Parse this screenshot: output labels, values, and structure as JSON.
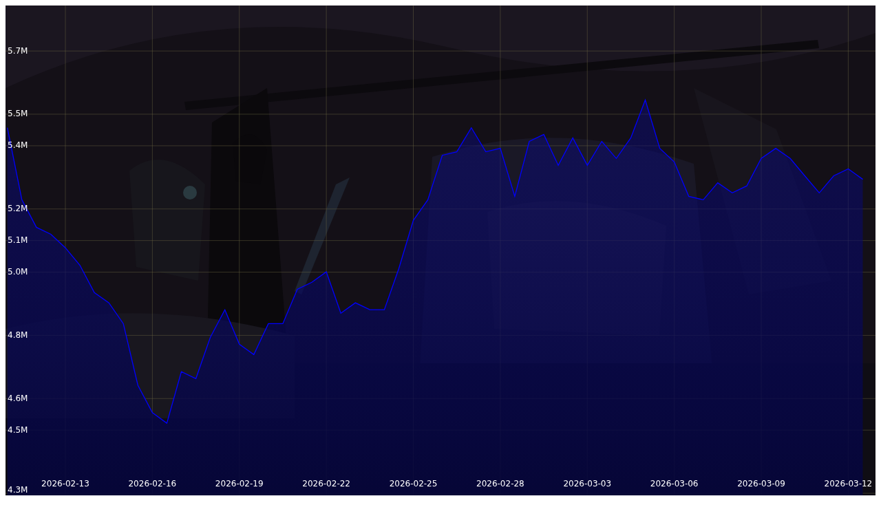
{
  "chart": {
    "chart_data": {
      "type": "area",
      "categories": [
        null,
        null,
        null,
        null,
        "2026-02-13",
        null,
        null,
        null,
        null,
        null,
        "2026-02-16",
        null,
        null,
        null,
        null,
        null,
        "2026-02-19",
        null,
        null,
        null,
        null,
        null,
        "2026-02-22",
        null,
        null,
        null,
        null,
        null,
        "2026-02-25",
        null,
        null,
        null,
        null,
        null,
        "2026-02-28",
        null,
        null,
        null,
        null,
        null,
        "2026-03-03",
        null,
        null,
        null,
        null,
        null,
        "2026-03-06",
        null,
        null,
        null,
        null,
        null,
        "2026-03-09",
        null,
        null,
        null,
        null,
        null,
        "2026-03-12",
        null
      ],
      "series": [
        {
          "color": "#0000ff",
          "values": [
            5.457,
            5.229,
            5.142,
            5.12,
            5.077,
            5.022,
            4.935,
            4.903,
            4.837,
            4.642,
            4.555,
            4.522,
            4.685,
            4.663,
            4.794,
            4.881,
            4.772,
            4.739,
            4.837,
            4.837,
            4.946,
            4.968,
            5.001,
            4.87,
            4.903,
            4.881,
            4.881,
            5.011,
            5.164,
            5.229,
            5.37,
            5.381,
            5.457,
            5.381,
            5.392,
            5.24,
            5.414,
            5.436,
            5.338,
            5.425,
            5.338,
            5.414,
            5.36,
            5.425,
            5.545,
            5.392,
            5.349,
            5.24,
            5.229,
            5.283,
            5.251,
            5.273,
            5.36,
            5.392,
            5.36,
            5.305,
            5.251,
            5.305,
            5.327,
            5.294
          ]
        }
      ],
      "ylim": [
        4.2935,
        5.844
      ],
      "grid": true,
      "yticks": [
        {
          "value": 4.3,
          "label": "4.3M"
        },
        {
          "value": 4.5,
          "label": "4.5M"
        },
        {
          "value": 4.6,
          "label": "4.6M"
        },
        {
          "value": 4.8,
          "label": "4.8M"
        },
        {
          "value": 5.0,
          "label": "5.0M"
        },
        {
          "value": 5.1,
          "label": "5.1M"
        },
        {
          "value": 5.2,
          "label": "5.2M"
        },
        {
          "value": 5.4,
          "label": "5.4M"
        },
        {
          "value": 5.5,
          "label": "5.5M"
        },
        {
          "value": 5.7,
          "label": "5.7M"
        }
      ]
    }
  }
}
